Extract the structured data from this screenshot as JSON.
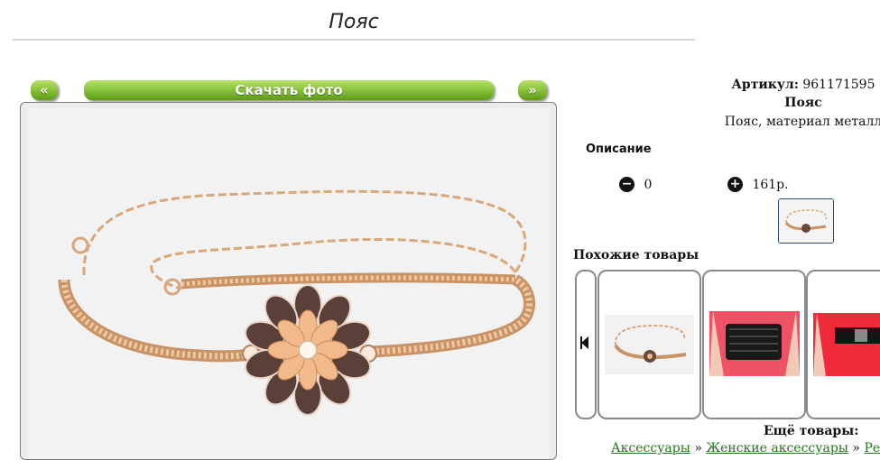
{
  "page": {
    "title": "Пояс"
  },
  "nav": {
    "prev_label": "«",
    "download_label": "Скачать фото",
    "next_label": "»"
  },
  "product": {
    "sku_label": "Артикул:",
    "sku_value": "961171595",
    "name": "Пояс",
    "description": "Пояс, материал металл",
    "description_label": "Описание",
    "quantity": "0",
    "price": "161р."
  },
  "icons": {
    "decrease": "minus-circle-icon",
    "increase": "plus-circle-icon",
    "carousel_prev": "skip-back-icon"
  },
  "similar": {
    "label": "Похожие товары",
    "items": [
      {
        "alt": "Пояс-цепочка"
      },
      {
        "alt": "Черный корсетный пояс"
      },
      {
        "alt": "Черный пояс на красном платье"
      }
    ]
  },
  "more": {
    "label": "Ещё товары:",
    "crumbs": [
      "Аксессуары",
      "Женские аксессуары",
      "Рем"
    ],
    "separator": "»"
  },
  "colors": {
    "button_green": "#8cc63e",
    "link_green": "#1e7a16",
    "chain_gold": "#d9a77a"
  }
}
